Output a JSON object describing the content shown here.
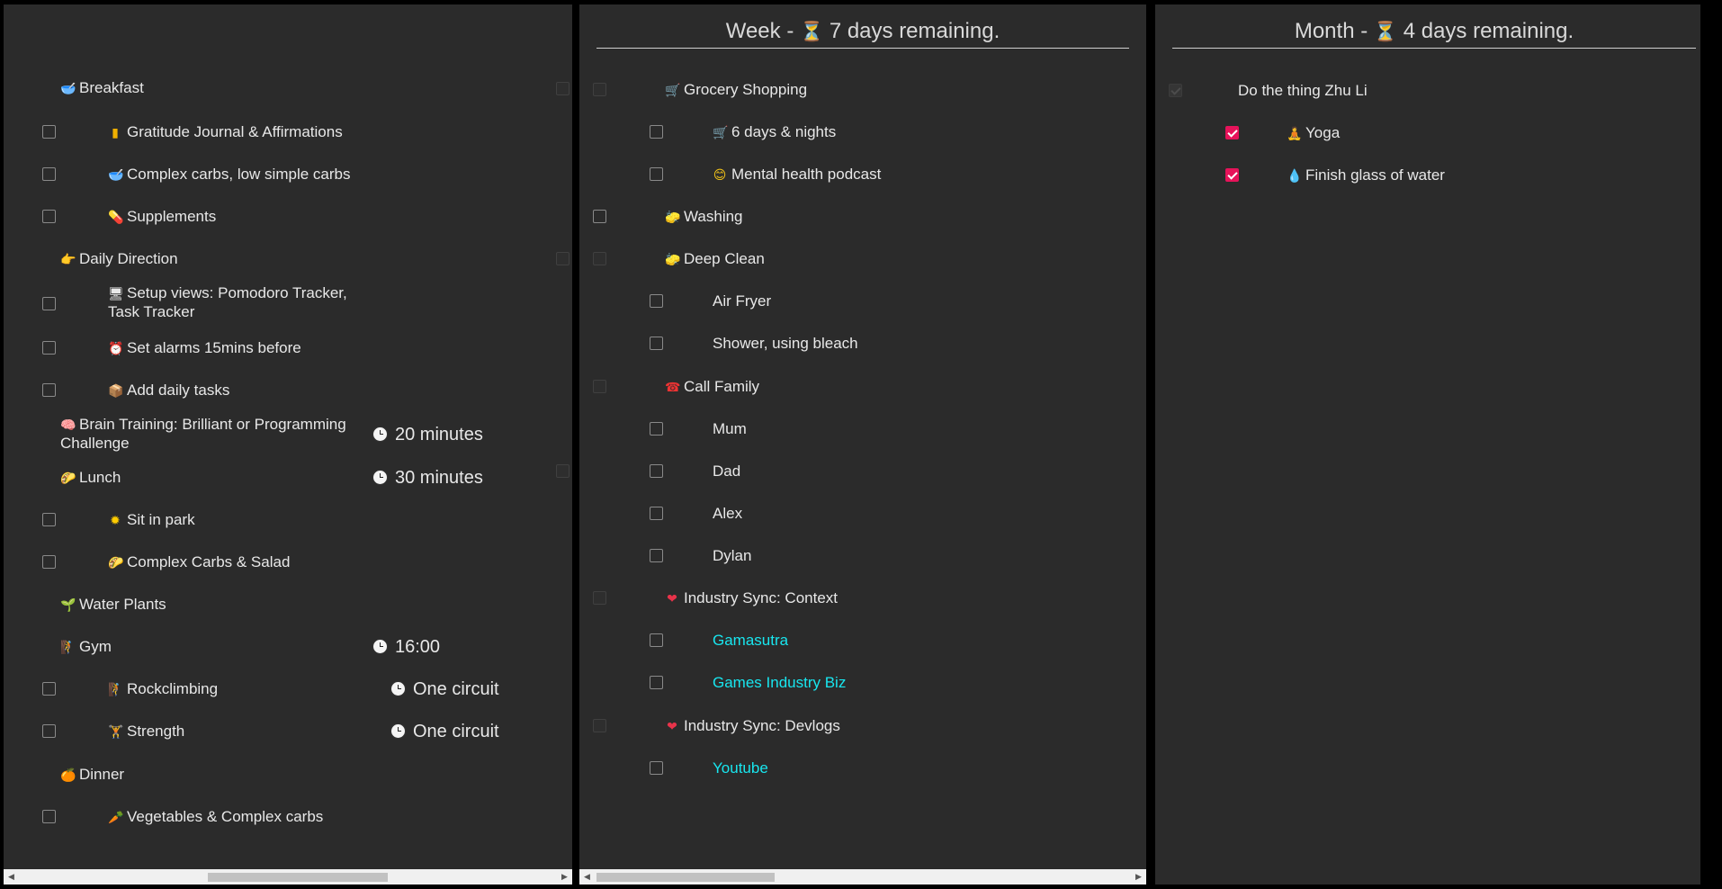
{
  "colors": {
    "panel_bg": "#2b2b2b",
    "link": "#18e6ef",
    "check": "#e6135a"
  },
  "week": {
    "title": "Week - ",
    "remaining": "7 days remaining.",
    "icon": "hourglass-icon"
  },
  "month": {
    "title": "Month - ",
    "remaining": "4 days remaining.",
    "icon": "hourglass-icon"
  },
  "daily": [
    {
      "icon": "🥣",
      "label": "Breakfast"
    },
    {
      "icon": "▮",
      "label": "Gratitude Journal & Affirmations"
    },
    {
      "icon": "🥣",
      "label": "Complex carbs, low simple carbs"
    },
    {
      "icon": "💊",
      "label": "Supplements"
    },
    {
      "icon": "👉",
      "label": "Daily Direction"
    },
    {
      "icon": "🖥",
      "label": "Setup views: Pomodoro Tracker, Task Tracker"
    },
    {
      "icon": "⏰",
      "label": "Set alarms 15mins before"
    },
    {
      "icon": "📦",
      "label": "Add daily tasks"
    },
    {
      "icon": "🧠",
      "label": "Brain Training: Brilliant or Programming Challenge",
      "time": "20 minutes"
    },
    {
      "icon": "🌮",
      "label": "Lunch",
      "time": "30 minutes"
    },
    {
      "icon": "✹",
      "label": "Sit in park"
    },
    {
      "icon": "🌮",
      "label": "Complex Carbs & Salad"
    },
    {
      "icon": "🌱",
      "label": "Water Plants"
    },
    {
      "icon": "🧗",
      "label": "Gym",
      "time": "16:00"
    },
    {
      "icon": "🧗",
      "label": "Rockclimbing",
      "time": "One circuit"
    },
    {
      "icon": "🏋",
      "label": "Strength",
      "time": "One circuit"
    },
    {
      "icon": "🍊",
      "label": "Dinner"
    },
    {
      "icon": "🥕",
      "label": "Vegetables & Complex carbs"
    }
  ],
  "weekly": [
    {
      "icon": "🛒",
      "label": "Grocery Shopping"
    },
    {
      "icon": "🛒",
      "label": "6 days & nights"
    },
    {
      "icon": "😊",
      "label": "Mental health podcast"
    },
    {
      "icon": "🧽",
      "label": "Washing"
    },
    {
      "icon": "🧽",
      "label": "Deep Clean"
    },
    {
      "icon": "",
      "label": "Air Fryer"
    },
    {
      "icon": "",
      "label": "Shower, using bleach"
    },
    {
      "icon": "☎",
      "label": "Call Family"
    },
    {
      "icon": "",
      "label": "Mum"
    },
    {
      "icon": "",
      "label": "Dad"
    },
    {
      "icon": "",
      "label": "Alex"
    },
    {
      "icon": "",
      "label": "Dylan"
    },
    {
      "icon": "❤",
      "label": "Industry Sync: Context"
    },
    {
      "icon": "",
      "label": "Gamasutra"
    },
    {
      "icon": "",
      "label": "Games Industry Biz"
    },
    {
      "icon": "❤",
      "label": "Industry Sync: Devlogs"
    },
    {
      "icon": "",
      "label": "Youtube"
    }
  ],
  "monthly": [
    {
      "icon": "",
      "label": "Do the thing Zhu Li"
    },
    {
      "icon": "🧘",
      "label": "Yoga"
    },
    {
      "icon": "💧",
      "label": "Finish glass of water"
    }
  ]
}
